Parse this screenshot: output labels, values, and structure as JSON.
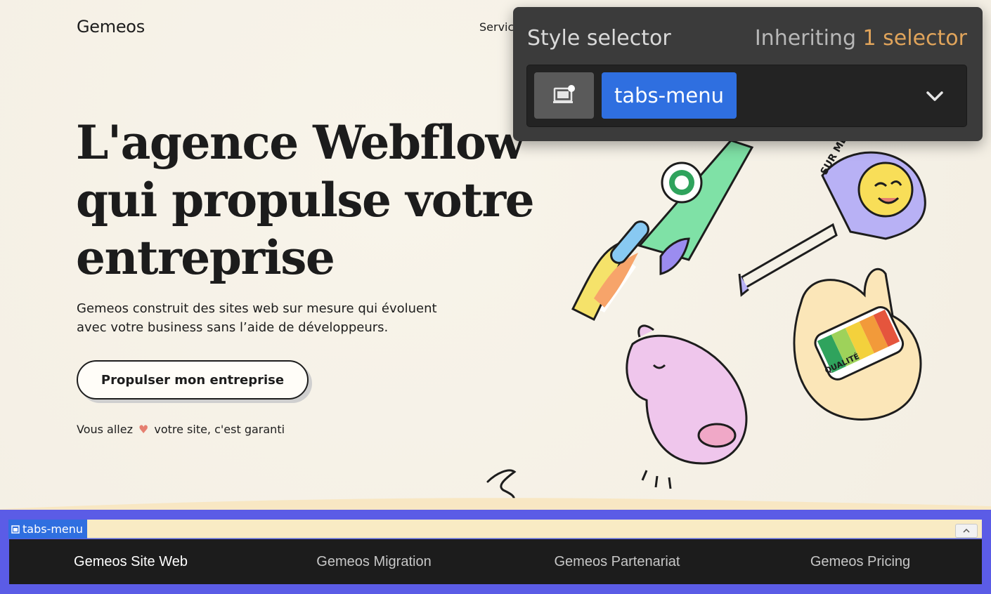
{
  "site": {
    "logo": "Gemeos",
    "nav_partial": "Servic"
  },
  "hero": {
    "title": "L'agence Webflow qui propulse votre entreprise",
    "subtitle": "Gemeos construit des sites web sur mesure qui évoluent avec votre business sans l’aide de développeurs.",
    "cta_label": "Propulser mon entreprise",
    "love_before": "Vous allez",
    "love_after": "votre site, c'est garanti"
  },
  "style_selector": {
    "title": "Style selector",
    "inheriting_label": "Inheriting",
    "inheriting_count": "1",
    "inheriting_unit": "selector",
    "selected_class": "tabs-menu",
    "device_icon": "desktop-state-icon",
    "dropdown_icon": "chevron-down-icon"
  },
  "tabs_menu": {
    "badge_label": "tabs-menu",
    "tabs": [
      {
        "label": "Gemeos Site Web",
        "active": true
      },
      {
        "label": "Gemeos Migration",
        "active": false
      },
      {
        "label": "Gemeos Partenariat",
        "active": false
      },
      {
        "label": "Gemeos Pricing",
        "active": false
      }
    ]
  },
  "colors": {
    "accent_blue": "#2f6fe0",
    "selection_outline": "#5b5ce6",
    "inherit_accent": "#e0a45b",
    "heart": "#e57f70"
  }
}
